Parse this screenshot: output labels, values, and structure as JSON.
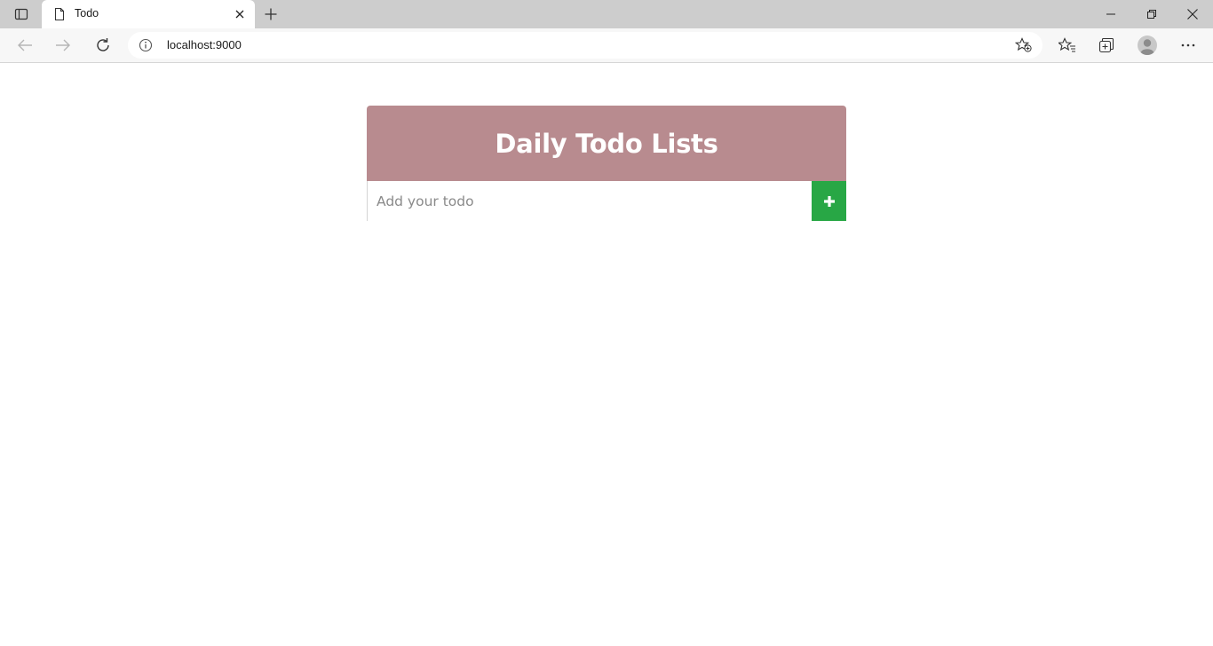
{
  "browser": {
    "tab": {
      "title": "Todo"
    },
    "address_bar": {
      "url": "localhost:9000"
    }
  },
  "page": {
    "title": "Daily Todo Lists",
    "todo_input": {
      "placeholder": "Add your todo",
      "value": ""
    },
    "add_button": {
      "icon": "plus-icon"
    }
  },
  "colors": {
    "header_bg": "#b88b8f",
    "add_button_bg": "#28a745",
    "header_text": "#ffffff"
  }
}
